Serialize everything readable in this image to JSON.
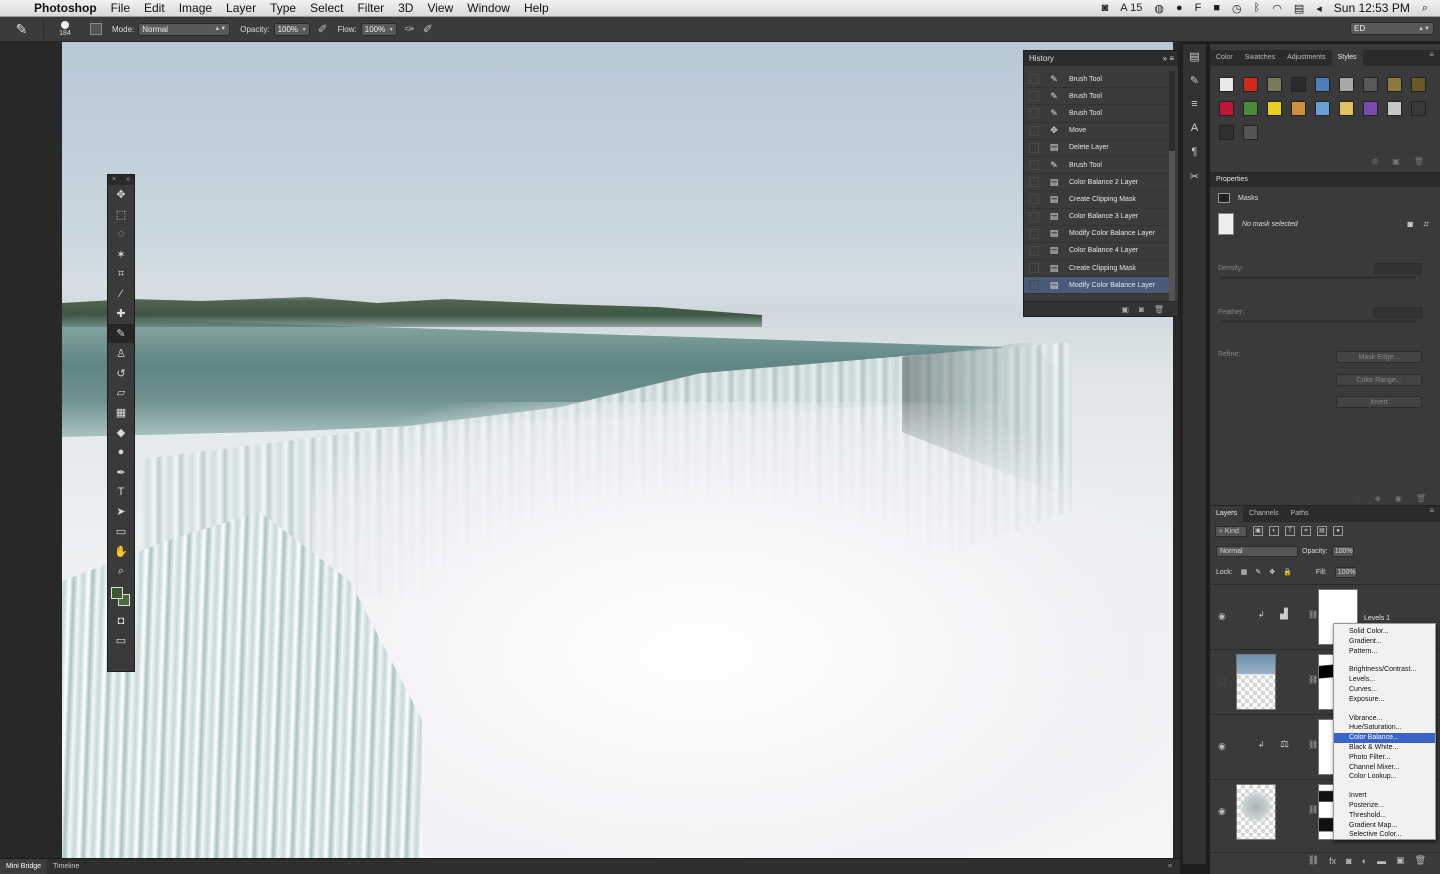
{
  "menubar": {
    "app_name": "Photoshop",
    "menus": [
      "File",
      "Edit",
      "Image",
      "Layer",
      "Type",
      "Select",
      "Filter",
      "3D",
      "View",
      "Window",
      "Help"
    ],
    "status_number": "15",
    "clock": "Sun 12:53 PM"
  },
  "options_bar": {
    "brush_size": "184",
    "mode_label": "Mode:",
    "mode_value": "Normal",
    "opacity_label": "Opacity:",
    "opacity_value": "100%",
    "flow_label": "Flow:",
    "flow_value": "100%",
    "workspace_value": "ED"
  },
  "history": {
    "title": "History",
    "items": [
      {
        "label": "Brush Tool",
        "icon": "brush-icon"
      },
      {
        "label": "Brush Tool",
        "icon": "brush-icon"
      },
      {
        "label": "Brush Tool",
        "icon": "brush-icon"
      },
      {
        "label": "Move",
        "icon": "move-icon"
      },
      {
        "label": "Delete Layer",
        "icon": "document-icon"
      },
      {
        "label": "Brush Tool",
        "icon": "brush-icon"
      },
      {
        "label": "Color Balance 2 Layer",
        "icon": "document-icon"
      },
      {
        "label": "Create Clipping Mask",
        "icon": "document-icon"
      },
      {
        "label": "Color Balance 3 Layer",
        "icon": "document-icon"
      },
      {
        "label": "Modify Color Balance Layer",
        "icon": "document-icon"
      },
      {
        "label": "Color Balance 4 Layer",
        "icon": "document-icon"
      },
      {
        "label": "Create Clipping Mask",
        "icon": "document-icon"
      },
      {
        "label": "Modify Color Balance Layer",
        "icon": "document-icon"
      }
    ],
    "selected_index": 12
  },
  "styles_panel": {
    "tabs": [
      "Color",
      "Swatches",
      "Adjustments",
      "Styles"
    ],
    "active_tab": "Styles",
    "swatch_colors": [
      "#e8e8e8",
      "#d22b1e",
      "#7a7a5a",
      "#2b2b2b",
      "#4b7fc0",
      "#a8a8a8",
      "#5a5a5a",
      "#8a7a40",
      "#6a5a2a",
      "#c2153a",
      "#4a8a3a",
      "#e8d020",
      "#d09040",
      "#6aa0d8",
      "#e0c060",
      "#7a4ab0",
      "#c8c8c8",
      "#3a3a3a",
      "#303030",
      "#555555"
    ]
  },
  "properties_panel": {
    "title": "Properties",
    "section": "Masks",
    "no_mask_text": "No mask selected",
    "density_label": "Density:",
    "feather_label": "Feather:",
    "refine_label": "Refine:",
    "buttons": [
      "Mask Edge...",
      "Color Range...",
      "Invert"
    ]
  },
  "layers_panel": {
    "tabs": [
      "Layers",
      "Channels",
      "Paths"
    ],
    "active_tab": "Layers",
    "kind_label": "Kind",
    "blend_mode": "Normal",
    "opacity_label": "Opacity:",
    "opacity_value": "100%",
    "lock_label": "Lock:",
    "fill_label": "Fill:",
    "fill_value": "100%",
    "layers": [
      {
        "name": "Levels 1"
      }
    ]
  },
  "adjustment_menu": {
    "groups": [
      [
        "Solid Color...",
        "Gradient...",
        "Pattern..."
      ],
      [
        "Brightness/Contrast...",
        "Levels...",
        "Curves...",
        "Exposure..."
      ],
      [
        "Vibrance...",
        "Hue/Saturation...",
        "Color Balance...",
        "Black & White...",
        "Photo Filter...",
        "Channel Mixer...",
        "Color Lookup..."
      ],
      [
        "Invert",
        "Posterize...",
        "Threshold...",
        "Gradient Map...",
        "Selective Color..."
      ]
    ],
    "highlighted": "Color Balance..."
  },
  "bottom_bar": {
    "tabs": [
      "Mini Bridge",
      "Timeline"
    ],
    "active_tab": "Mini Bridge"
  },
  "tools_fg_color": "#3a5a2e",
  "tools_bg_color": "#4d6b3a"
}
